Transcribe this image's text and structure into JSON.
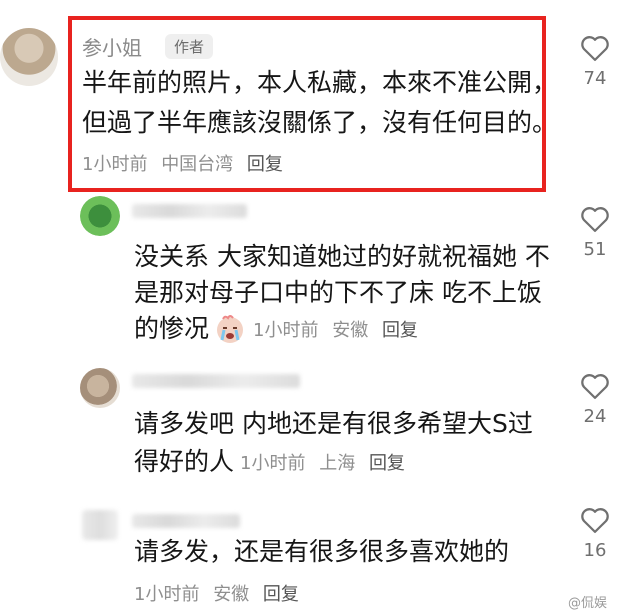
{
  "comments": [
    {
      "username": "参小姐",
      "badge": "作者",
      "line1": "半年前的照片，本人私藏，本來不准公開，",
      "line2": "但過了半年應該沒關係了，沒有任何目的。",
      "time": "1小时前",
      "location": "中国台湾",
      "reply": "回复",
      "likes": "74"
    },
    {
      "line1": "没关系 大家知道她过的好就祝福她 不",
      "line2": "是那对母子口中的下不了床 吃不上饭",
      "line3": "的惨况",
      "emoji": "crying-face-emoji",
      "time": "1小时前",
      "location": "安徽",
      "reply": "回复",
      "likes": "51"
    },
    {
      "line1": "请多发吧 内地还是有很多希望大S过",
      "line2": "得好的人",
      "time": "1小时前",
      "location": "上海",
      "reply": "回复",
      "likes": "24"
    },
    {
      "line1": "请多发，还是有很多很多喜欢她的",
      "time": "1小时前",
      "location": "安徽",
      "reply": "回复",
      "likes": "16"
    }
  ],
  "watermark": "@侃娱",
  "colors": {
    "highlight": "#e8231f",
    "meta": "#8f8f8f"
  },
  "icons": {
    "like": "heart-outline-icon"
  }
}
